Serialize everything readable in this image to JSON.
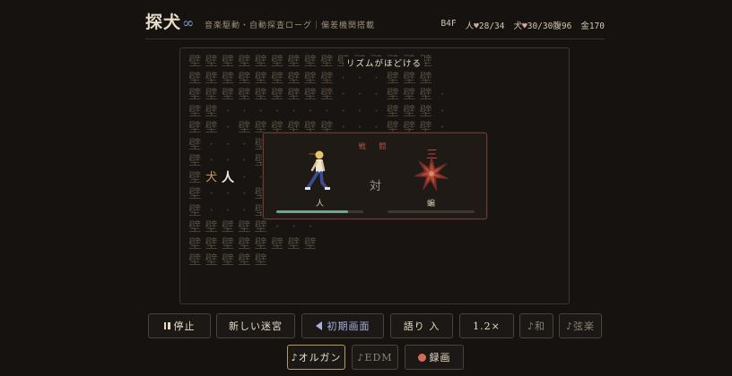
{
  "header": {
    "logo": "探犬",
    "logo_suffix": "∞",
    "subtitle": "音楽駆動・自動探査ローグ｜偏差機関搭載",
    "floor": "B4F",
    "human_label": "人",
    "human_hp": "28/34",
    "dog_label": "犬",
    "dog_hp": "30/30",
    "hunger_label": "腹",
    "hunger": "96",
    "gold_label": "金",
    "gold": "170"
  },
  "map": {
    "message": "リズムがほどける",
    "rows": [
      "壁壁壁壁壁壁壁壁壁壁壁壁壁壁壁",
      "壁壁壁壁壁壁壁壁壁・・・壁壁壁",
      "壁壁壁壁壁壁壁壁壁・・・壁壁壁・",
      "壁壁・・・・・・・・・・壁壁壁・",
      "壁壁・壁壁壁壁壁壁・・・壁壁壁・",
      "壁・・・壁",
      "壁・・・壁",
      "壁犬人・・",
      "壁・・・壁",
      "壁・・・壁",
      "壁壁壁壁壁・・・",
      "壁壁壁壁壁壁壁壁",
      "壁壁壁壁壁"
    ]
  },
  "battle": {
    "title": "戦 闘",
    "versus": "対",
    "player_name": "人",
    "enemy_name": "蝙",
    "player_marks": "一",
    "enemy_marks": "三",
    "player_hp_fraction": 0.82,
    "enemy_hp_fraction": 0.0
  },
  "controls": {
    "stop_label": "停止",
    "new_maze_label": "新しい迷宮",
    "title_screen_label": "初期画面",
    "narrate_label": "語り 入",
    "speed_label": "1.2×",
    "wa_label": "♪和",
    "strings_label": "♪弦楽",
    "organ_label": "♪オルガン",
    "edm_label": "♪EDM",
    "record_label": "録画"
  },
  "colors": {
    "background": "#15120f",
    "accent_blue": "#a8b0e0",
    "battle_border": "#6b3a30",
    "hp_green": "#6fa58f",
    "record_red": "#d36a5c"
  }
}
